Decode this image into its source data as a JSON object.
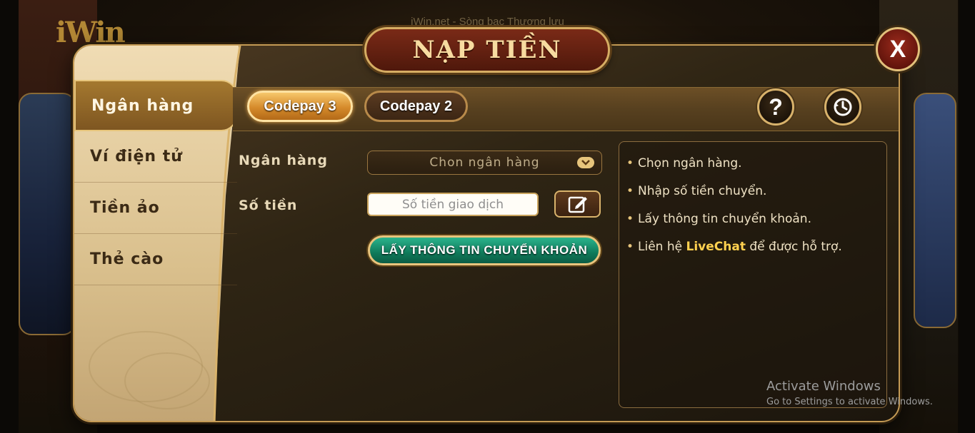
{
  "background": {
    "caption": "iWin.net - Sòng bạc Thượng lưu",
    "logo_text": "iWin"
  },
  "dialog": {
    "title": "NẠP TIỀN",
    "close_label": "X",
    "sidebar": {
      "items": [
        {
          "label": "Ngân hàng",
          "active": true
        },
        {
          "label": "Ví điện tử",
          "active": false
        },
        {
          "label": "Tiền ảo",
          "active": false
        },
        {
          "label": "Thẻ cào",
          "active": false
        }
      ]
    },
    "tabs": [
      {
        "label": "Codepay 3",
        "active": true
      },
      {
        "label": "Codepay 2",
        "active": false
      }
    ],
    "help_icon": "question-icon",
    "history_icon": "history-icon",
    "form": {
      "bank_label": "Ngân hàng",
      "bank_placeholder": "Chon ngân hàng",
      "amount_label": "Số tiền",
      "amount_placeholder": "Số tiền giao dịch",
      "submit_label": "LẤY THÔNG TIN CHUYỂN KHOẢN"
    },
    "instructions": {
      "line1": "Chọn ngân hàng.",
      "line2": "Nhập số tiền chuyển.",
      "line3": "Lấy thông tin chuyển khoản.",
      "line4_prefix": "Liên hệ",
      "line4_highlight": "LiveChat",
      "line4_suffix": "để được hỗ trợ."
    }
  },
  "watermark": {
    "title": "Activate Windows",
    "subtitle": "Go to Settings to activate Windows."
  },
  "colors": {
    "gold": "#d8b26b",
    "highlight": "#ffd14f",
    "cta_green": "#0f7a5a"
  }
}
